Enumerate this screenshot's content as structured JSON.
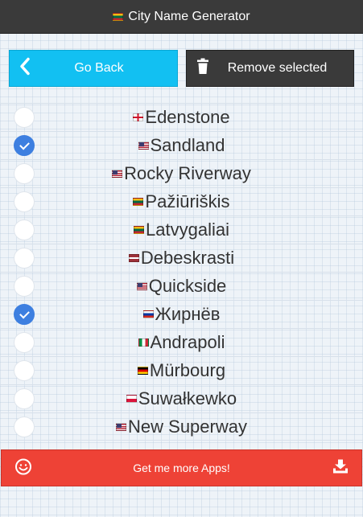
{
  "header": {
    "title": "City Name Generator",
    "flag": "lt"
  },
  "toolbar": {
    "back_label": "Go Back",
    "back_icon": "chevron-left-icon",
    "remove_label": "Remove selected",
    "remove_icon": "trash-icon"
  },
  "cities": [
    {
      "name": "Edenstone",
      "flag": "en",
      "selected": false
    },
    {
      "name": "Sandland",
      "flag": "us",
      "selected": true
    },
    {
      "name": "Rocky Riverway",
      "flag": "us",
      "selected": false
    },
    {
      "name": "Pažiūriškis",
      "flag": "lt",
      "selected": false
    },
    {
      "name": "Latvygaliai",
      "flag": "lt",
      "selected": false
    },
    {
      "name": "Debeskrasti",
      "flag": "lv",
      "selected": false
    },
    {
      "name": "Quickside",
      "flag": "us",
      "selected": false
    },
    {
      "name": "Жирнёв",
      "flag": "ru",
      "selected": true
    },
    {
      "name": "Andrapoli",
      "flag": "it",
      "selected": false
    },
    {
      "name": "Mürbourg",
      "flag": "de",
      "selected": false
    },
    {
      "name": "Suwałkewko",
      "flag": "pl",
      "selected": false
    },
    {
      "name": "New Superway",
      "flag": "us",
      "selected": false
    }
  ],
  "footer": {
    "label": "Get me more Apps!",
    "left_icon": "smiley-icon",
    "right_icon": "download-icon"
  },
  "colors": {
    "header_bg": "#3a3a3a",
    "back_button": "#12c0f2",
    "remove_button": "#3a3a3a",
    "footer_button": "#ee4236",
    "checked": "#3d7fe0"
  }
}
